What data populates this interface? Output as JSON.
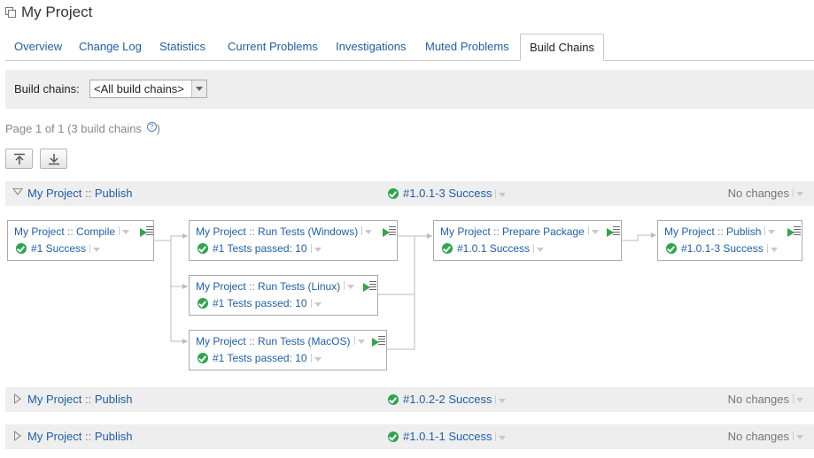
{
  "header": {
    "title": "My Project",
    "icon": "project-icon"
  },
  "tabs": [
    {
      "label": "Overview"
    },
    {
      "label": "Change Log"
    },
    {
      "label": "Statistics"
    },
    {
      "label": "Current Problems"
    },
    {
      "label": "Investigations"
    },
    {
      "label": "Muted Problems"
    },
    {
      "label": "Build Chains",
      "active": true
    }
  ],
  "filter": {
    "label": "Build chains:",
    "selected": "<All build chains>"
  },
  "pager": {
    "text": "Page 1 of 1 (3 build chains",
    "close": ")"
  },
  "toolbar": {
    "expand_all_icon": "expand-all-icon",
    "collapse_all_icon": "collapse-all-icon"
  },
  "chains": [
    {
      "project": "My Project",
      "separator": "::",
      "config": "Publish",
      "number": "#1.0.1-3 Success",
      "changes": "No changes",
      "expanded": true,
      "nodes": [
        {
          "project": "My Project",
          "config": "Compile",
          "status": "#1 Success"
        },
        {
          "project": "My Project",
          "config": "Run Tests (Windows)",
          "status": "#1 Tests passed: 10"
        },
        {
          "project": "My Project",
          "config": "Run Tests (Linux)",
          "status": "#1 Tests passed: 10"
        },
        {
          "project": "My Project",
          "config": "Run Tests (MacOS)",
          "status": "#1 Tests passed: 10"
        },
        {
          "project": "My Project",
          "config": "Prepare Package",
          "status": "#1.0.1 Success"
        },
        {
          "project": "My Project",
          "config": "Publish",
          "status": "#1.0.1-3 Success"
        }
      ]
    },
    {
      "project": "My Project",
      "separator": "::",
      "config": "Publish",
      "number": "#1.0.2-2 Success",
      "changes": "No changes",
      "expanded": false
    },
    {
      "project": "My Project",
      "separator": "::",
      "config": "Publish",
      "number": "#1.0.1-1 Success",
      "changes": "No changes",
      "expanded": false
    }
  ],
  "colors": {
    "link": "#1f5fa8",
    "success": "#2ea44f",
    "panel": "#eeeeee"
  }
}
